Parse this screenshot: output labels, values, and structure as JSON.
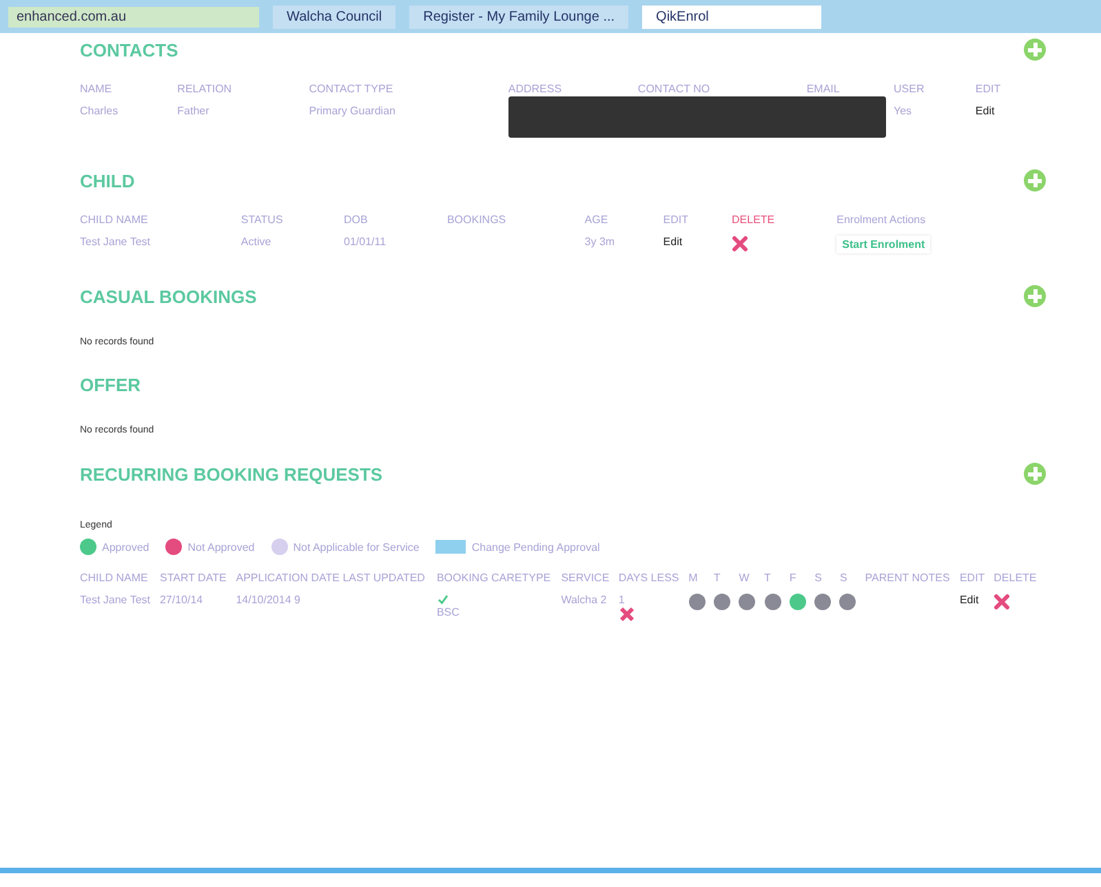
{
  "browser": {
    "address": "enhanced.com.au",
    "tabs": [
      {
        "title": "Walcha Council",
        "selected": false
      },
      {
        "title": "Register - My Family Lounge ...",
        "selected": false
      },
      {
        "title": "QikEnrol",
        "selected": true
      }
    ]
  },
  "contacts": {
    "title": "CONTACTS",
    "columns": [
      "NAME",
      "RELATION",
      "CONTACT TYPE",
      "ADDRESS",
      "CONTACT NO",
      "EMAIL",
      "USER",
      "EDIT"
    ],
    "rows": [
      {
        "name": "Charles",
        "relation": "Father",
        "contact_type": "Primary Guardian",
        "user": "Yes",
        "edit": "Edit"
      }
    ]
  },
  "child": {
    "title": "CHILD",
    "columns": [
      "CHILD NAME",
      "STATUS",
      "DOB",
      "BOOKINGS",
      "AGE",
      "EDIT",
      "DELETE",
      "Enrolment Actions"
    ],
    "rows": [
      {
        "name": "Test Jane Test",
        "status": "Active",
        "dob": "01/01/11",
        "age": "3y 3m",
        "edit": "Edit",
        "action": "Start Enrolment"
      }
    ]
  },
  "casual_bookings": {
    "title": "CASUAL BOOKINGS",
    "empty": "No records found"
  },
  "offer": {
    "title": "OFFER",
    "empty": "No records found"
  },
  "recurring": {
    "title": "RECURRING BOOKING REQUESTS",
    "legend_title": "Legend",
    "legend": [
      {
        "kind": "approved",
        "label": "Approved"
      },
      {
        "kind": "rejected",
        "label": "Not Approved"
      },
      {
        "kind": "na",
        "label": "Not Applicable for Service"
      },
      {
        "kind": "pending",
        "label": "Change Pending Approval"
      }
    ],
    "columns": [
      "CHILD NAME",
      "START DATE",
      "APPLICATION DATE LAST UPDATED",
      "BOOKING CARETYPE",
      "SERVICE",
      "DAYS LESS",
      "M",
      "T",
      "W",
      "T",
      "F",
      "S",
      "S",
      "PARENT NOTES",
      "EDIT",
      "DELETE"
    ],
    "rows": [
      {
        "name": "Test Jane Test",
        "start": "27/10/14",
        "updated": "14/10/2014 9",
        "approved": true,
        "caretype": "BSC",
        "service": "Walcha 2",
        "days": "1",
        "days_ok": false,
        "days_status": [
          {
            "kind": "na"
          },
          {
            "kind": "na"
          },
          {
            "kind": "na"
          },
          {
            "kind": "na"
          },
          {
            "kind": "approved"
          },
          {
            "kind": "na"
          },
          {
            "kind": "na"
          }
        ],
        "edit": "Edit"
      }
    ]
  }
}
